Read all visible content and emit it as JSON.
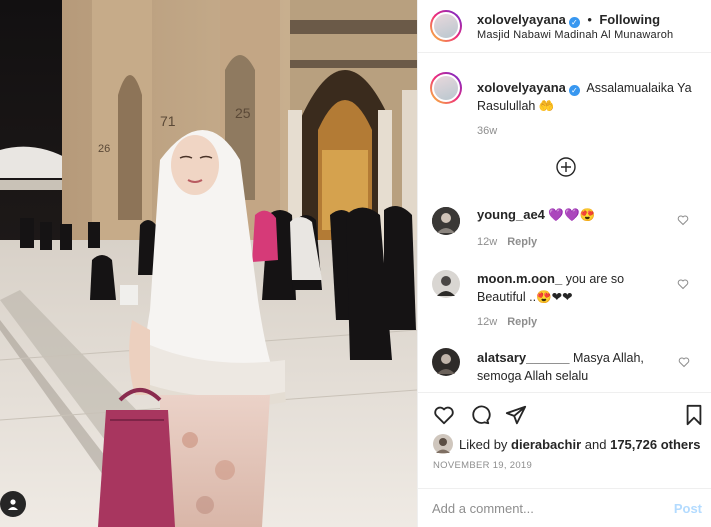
{
  "post": {
    "username": "xolovelyayana",
    "follow_state": "Following",
    "location": "Masjid Nabawi Madinah Al Munawaroh"
  },
  "caption": {
    "username": "xolovelyayana",
    "text_line1": "Assalamualaika Ya",
    "text_line2": "Rasulullah 🤲",
    "time": "36w"
  },
  "comments": [
    {
      "username": "young_ae4",
      "text": "💜💜😍",
      "time": "12w",
      "reply": "Reply"
    },
    {
      "username": "moon.m.oon_",
      "text_line1": "you are so",
      "text_line2": "Beautiful ..😍❤❤",
      "time": "12w",
      "reply": "Reply"
    },
    {
      "username": "alatsary______",
      "text_line1": "Masya Allah,",
      "text_line2": "semoga Allah selalu"
    }
  ],
  "likes": {
    "prefix": "Liked by",
    "user": "dierabachir",
    "middle": "and",
    "count": "175,726 others"
  },
  "date": "NOVEMBER 19, 2019",
  "composer": {
    "placeholder": "Add a comment...",
    "post_label": "Post"
  },
  "photo_overlay": {
    "numbers": [
      "25",
      "26",
      "71"
    ]
  },
  "colors": {
    "verified": "#3897f0",
    "post_link_disabled": "#b3dbff",
    "muted": "#8e8e8e"
  }
}
